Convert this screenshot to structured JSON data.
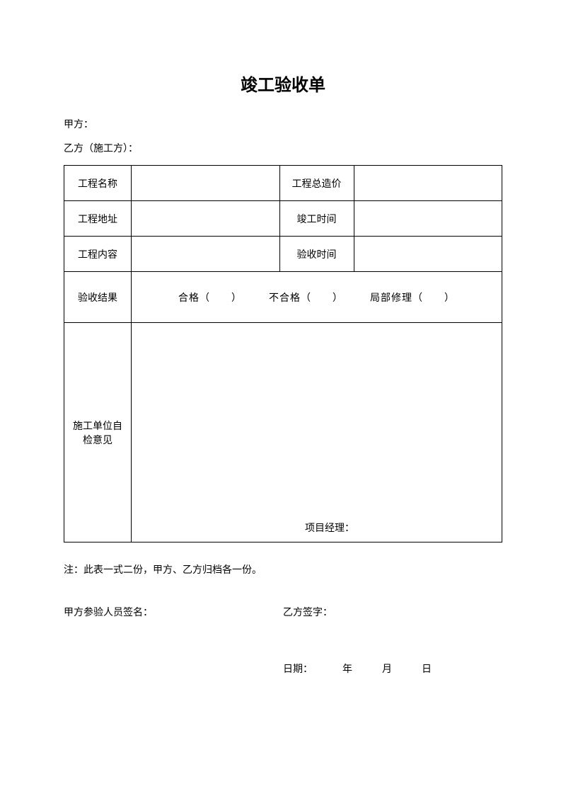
{
  "title": "竣工验收单",
  "party_a_label": "甲方：",
  "party_b_label": "乙方（施工方）：",
  "table": {
    "project_name_label": "工程名称",
    "project_name_value": "",
    "total_price_label": "工程总造价",
    "total_price_value": "",
    "project_address_label": "工程地址",
    "project_address_value": "",
    "completion_time_label": "竣工时间",
    "completion_time_value": "",
    "project_content_label": "工程内容",
    "project_content_value": "",
    "acceptance_time_label": "验收时间",
    "acceptance_time_value": "",
    "result_label": "验收结果",
    "result_options_text": "合格（　　）　　　不合格（　　）　　　局部修理（　　）",
    "opinion_label": "施工单位自检意见",
    "manager_label": "项目经理："
  },
  "note": "注：此表一式二份，甲方、乙方归档各一份。",
  "signature_a_label": "甲方参验人员签名：",
  "signature_b_label": "乙方签字：",
  "date": {
    "label": "日期：",
    "year": "年",
    "month": "月",
    "day": "日"
  }
}
